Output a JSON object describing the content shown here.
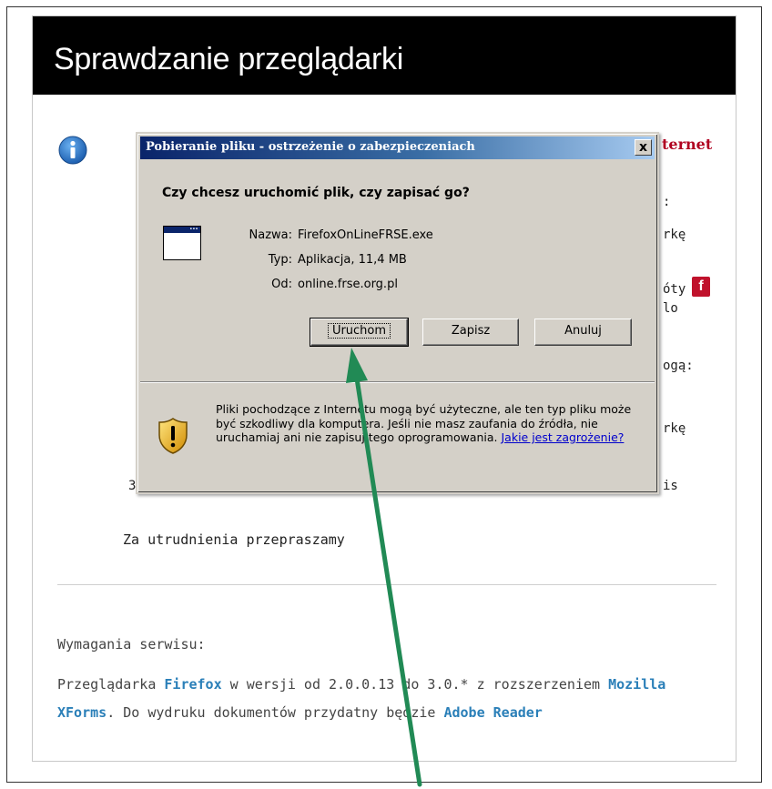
{
  "page": {
    "title": "Sprawdzanie przeglądarki",
    "partial_red": "ternet",
    "bg_fragments": [
      ":",
      "rkę",
      "óty",
      "lo",
      "ogą:",
      "rkę",
      "is",
      "3"
    ],
    "sorry": "Za utrudnienia przepraszamy",
    "requirements_heading": "Wymagania serwisu:",
    "requirements": {
      "t1": "Przeglądarka ",
      "firefox": "Firefox",
      "t2": " w wersji od 2.0.0.13 do 3.0.* z rozszerzeniem ",
      "mozilla": "Mozilla XForms",
      "t3": ". Do wydruku dokumentów przydatny będzie ",
      "adobe": "Adobe Reader"
    },
    "colors": {
      "header_bg": "#000000",
      "link": "#2a7fb8",
      "alert_red": "#b00020"
    }
  },
  "dialog": {
    "title": "Pobieranie pliku - ostrzeżenie o zabezpieczeniach",
    "close": "x",
    "question": "Czy chcesz uruchomić plik, czy zapisać go?",
    "icon": "application-window-icon",
    "fields": [
      {
        "label": "Nazwa:",
        "value": "FirefoxOnLineFRSE.exe"
      },
      {
        "label": "Typ:",
        "value": "Aplikacja, 11,4 MB"
      },
      {
        "label": "Od:",
        "value": "online.frse.org.pl"
      }
    ],
    "buttons": {
      "run": "Uruchom",
      "save": "Zapisz",
      "cancel": "Anuluj"
    },
    "warning": {
      "text": "Pliki pochodzące z Internetu mogą być użyteczne, ale ten typ pliku może być szkodliwy dla komputera. Jeśli nie masz zaufania do źródła, nie uruchamiaj ani nie zapisuj tego oprogramowania. ",
      "link": "Jakie jest zagrożenie?"
    }
  }
}
